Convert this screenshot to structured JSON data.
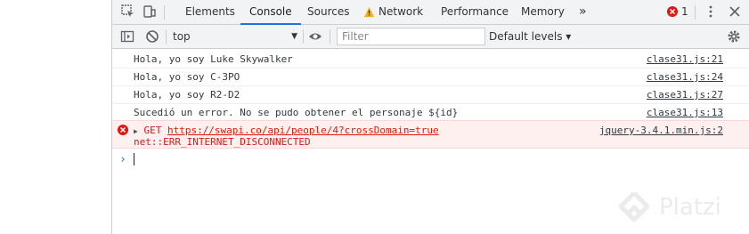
{
  "tabs": [
    {
      "label": "Elements"
    },
    {
      "label": "Console"
    },
    {
      "label": "Sources"
    },
    {
      "label": "Network"
    },
    {
      "label": "Performance"
    },
    {
      "label": "Memory"
    }
  ],
  "more_tabs": "»",
  "error_count": "1",
  "toolbar": {
    "context": "top",
    "filter_placeholder": "Filter",
    "levels": "Default levels ▾"
  },
  "messages": [
    {
      "text": "Hola, yo soy Luke Skywalker",
      "source": "clase31.js:21"
    },
    {
      "text": "Hola, yo soy C-3PO",
      "source": "clase31.js:24"
    },
    {
      "text": "Hola, yo soy R2-D2",
      "source": "clase31.js:27"
    },
    {
      "text": "Sucedió un error. No se pudo obtener el personaje ${id}",
      "source": "clase31.js:13"
    }
  ],
  "error": {
    "method": "GET",
    "url": "https://swapi.co/api/people/4?crossDomain=true",
    "detail": "net::ERR_INTERNET_DISCONNECTED",
    "source": "jquery-3.4.1.min.js:2"
  },
  "prompt": "›",
  "watermark": "Platzi",
  "colors": {
    "accent": "#1a73e8",
    "error": "#e0160f",
    "error_bg": "#fff0f0"
  }
}
